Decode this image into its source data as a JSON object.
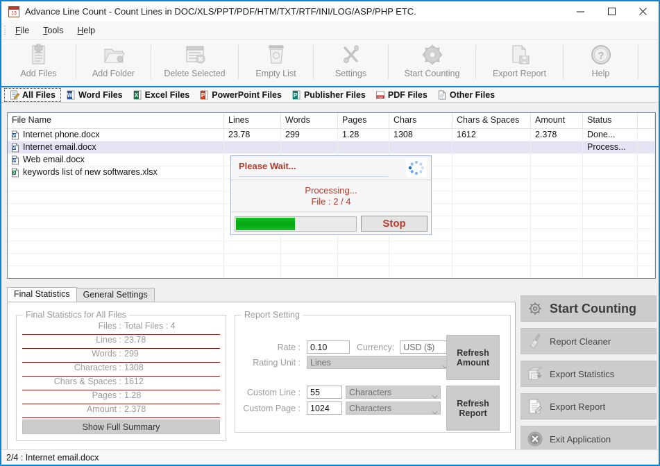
{
  "window": {
    "title": "Advance Line Count - Count Lines in DOC/XLS/PPT/PDF/HTM/TXT/RTF/INI/LOG/ASP/PHP ETC.",
    "icon": "calendar-icon",
    "minimize": "—",
    "maximize": "□",
    "close": "✕"
  },
  "menu": {
    "items": [
      {
        "label": "File",
        "mnemonic": "F"
      },
      {
        "label": "Tools",
        "mnemonic": "T"
      },
      {
        "label": "Help",
        "mnemonic": "H"
      }
    ]
  },
  "toolbar": {
    "buttons": [
      {
        "label": "Add Files",
        "icon": "add-files-icon"
      },
      {
        "label": "Add Folder",
        "icon": "add-folder-icon"
      },
      {
        "label": "Delete Selected",
        "icon": "delete-selected-icon"
      },
      {
        "label": "Empty List",
        "icon": "empty-list-icon"
      },
      {
        "label": "Settings",
        "icon": "settings-wrench-icon"
      },
      {
        "label": "Start Counting",
        "icon": "gear-icon"
      },
      {
        "label": "Export Report",
        "icon": "export-report-icon"
      },
      {
        "label": "Help",
        "icon": "help-question-icon"
      }
    ]
  },
  "file_tabs": {
    "items": [
      {
        "label": "All Files",
        "icon": "all-files-icon",
        "active": true
      },
      {
        "label": "Word Files",
        "icon": "word-icon",
        "active": false
      },
      {
        "label": "Excel Files",
        "icon": "excel-icon",
        "active": false
      },
      {
        "label": "PowerPoint Files",
        "icon": "powerpoint-icon",
        "active": false
      },
      {
        "label": "Publisher Files",
        "icon": "publisher-icon",
        "active": false
      },
      {
        "label": "PDF Files",
        "icon": "pdf-icon",
        "active": false
      },
      {
        "label": "Other Files",
        "icon": "other-files-icon",
        "active": false
      }
    ]
  },
  "file_list": {
    "columns": [
      "File Name",
      "Lines",
      "Words",
      "Pages",
      "Chars",
      "Chars & Spaces",
      "Amount",
      "Status"
    ],
    "rows": [
      {
        "icon": "word-doc-icon",
        "name": "Internet phone.docx",
        "lines": "23.78",
        "words": "299",
        "pages": "1.28",
        "chars": "1308",
        "chars_spaces": "1612",
        "amount": "2.378",
        "status": "Done...",
        "selected": false
      },
      {
        "icon": "word-doc-icon",
        "name": "Internet email.docx",
        "lines": "",
        "words": "",
        "pages": "",
        "chars": "",
        "chars_spaces": "",
        "amount": "",
        "status": "Process...",
        "selected": true
      },
      {
        "icon": "word-doc-icon",
        "name": "Web email.docx",
        "lines": "",
        "words": "",
        "pages": "",
        "chars": "",
        "chars_spaces": "",
        "amount": "",
        "status": "",
        "selected": false
      },
      {
        "icon": "excel-doc-icon",
        "name": "keywords list of new softwares.xlsx",
        "lines": "",
        "words": "",
        "pages": "",
        "chars": "",
        "chars_spaces": "",
        "amount": "",
        "status": "",
        "selected": false
      }
    ]
  },
  "please_wait_dialog": {
    "title": "Please Wait...",
    "spinner_icon": "loading-spinner-icon",
    "line1": "Processing...",
    "line2": "File : 2 / 4",
    "progress_percent": 50,
    "stop_label": "Stop",
    "progress_color": "#06a814",
    "text_color": "#b03a2e"
  },
  "lower_tabs": {
    "items": [
      {
        "label": "Final Statistics",
        "active": true
      },
      {
        "label": "General Settings",
        "active": false
      }
    ]
  },
  "final_statistics": {
    "group_caption": "Final Statistics for All Files",
    "rows": [
      {
        "key": "Files :",
        "value": "Total Files : 4"
      },
      {
        "key": "Lines :",
        "value": "23.78"
      },
      {
        "key": "Words :",
        "value": "299"
      },
      {
        "key": "Characters :",
        "value": "1308"
      },
      {
        "key": "Chars & Spaces :",
        "value": "1612"
      },
      {
        "key": "Pages :",
        "value": "1.28"
      },
      {
        "key": "Amount :",
        "value": "2.378"
      }
    ],
    "summary_button": "Show Full Summary"
  },
  "report_setting": {
    "group_caption": "Report Setting",
    "rate_label": "Rate :",
    "rate_value": "0.10",
    "currency_label": "Currency:",
    "currency_value": "USD ($)",
    "rating_unit_label": "Rating Unit :",
    "rating_unit_value": "Lines",
    "custom_line_label": "Custom Line :",
    "custom_line_value": "55",
    "custom_line_unit": "Characters",
    "custom_page_label": "Custom Page :",
    "custom_page_value": "1024",
    "custom_page_unit": "Characters",
    "refresh_amount_button": "Refresh\nAmount",
    "refresh_amount_line1": "Refresh",
    "refresh_amount_line2": "Amount",
    "refresh_report_line1": "Refresh",
    "refresh_report_line2": "Report"
  },
  "actions": {
    "buttons": [
      {
        "label": "Start Counting",
        "icon": "gear-icon",
        "primary": true
      },
      {
        "label": "Report Cleaner",
        "icon": "broom-icon",
        "primary": false
      },
      {
        "label": "Export Statistics",
        "icon": "export-statistics-icon",
        "primary": false
      },
      {
        "label": "Export Report",
        "icon": "export-report-icon",
        "primary": false
      },
      {
        "label": "Exit Application",
        "icon": "exit-x-icon",
        "primary": false
      }
    ]
  },
  "status_bar": {
    "text": "2/4 : Internet email.docx"
  },
  "colors": {
    "window_border": "#0a84d8",
    "accent_red": "#b03a2e",
    "progress_green": "#06a814",
    "selection": "#e4e4f4",
    "stat_underline": "#8b1a1a"
  }
}
